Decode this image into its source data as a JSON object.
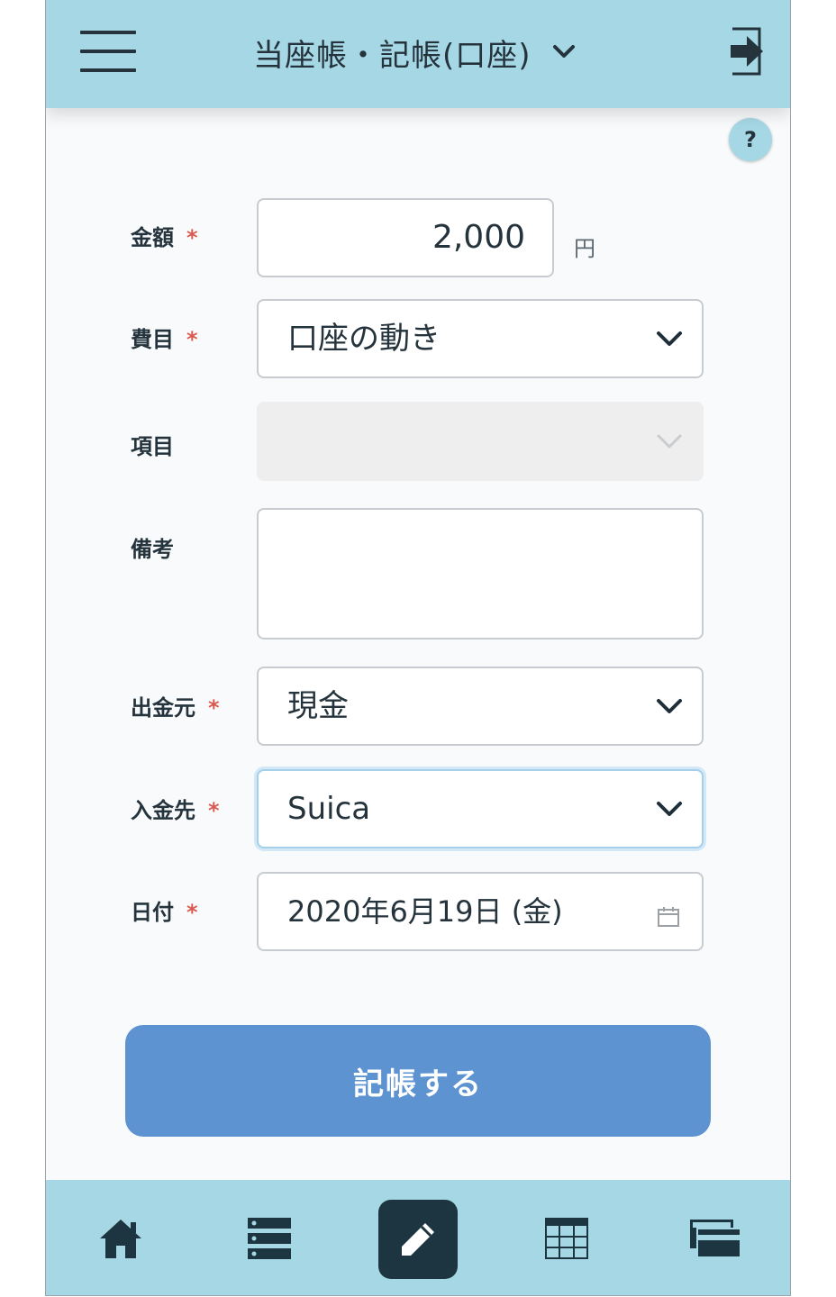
{
  "header": {
    "title": "当座帳・記帳(口座)"
  },
  "help": {
    "label": "?"
  },
  "form": {
    "amount": {
      "label": "金額",
      "required_mark": "*",
      "value": "2,000",
      "unit": "円"
    },
    "category": {
      "label": "費目",
      "required_mark": "*",
      "value": "口座の動き"
    },
    "item": {
      "label": "項目",
      "value": ""
    },
    "memo": {
      "label": "備考",
      "value": ""
    },
    "from_account": {
      "label": "出金元",
      "required_mark": "*",
      "value": "現金"
    },
    "to_account": {
      "label": "入金先",
      "required_mark": "*",
      "value": "Suica"
    },
    "date": {
      "label": "日付",
      "required_mark": "*",
      "value": "2020年6月19日 (金)"
    }
  },
  "submit_label": "記帳する",
  "footer_nav": [
    {
      "icon": "home-icon"
    },
    {
      "icon": "list-icon"
    },
    {
      "icon": "pencil-icon",
      "active": true
    },
    {
      "icon": "table-icon"
    },
    {
      "icon": "wallet-icon"
    }
  ],
  "colors": {
    "header_bg": "#a5d7e4",
    "button_bg": "#5d93d1",
    "required": "#d95a50",
    "active_nav": "#1d3540"
  }
}
